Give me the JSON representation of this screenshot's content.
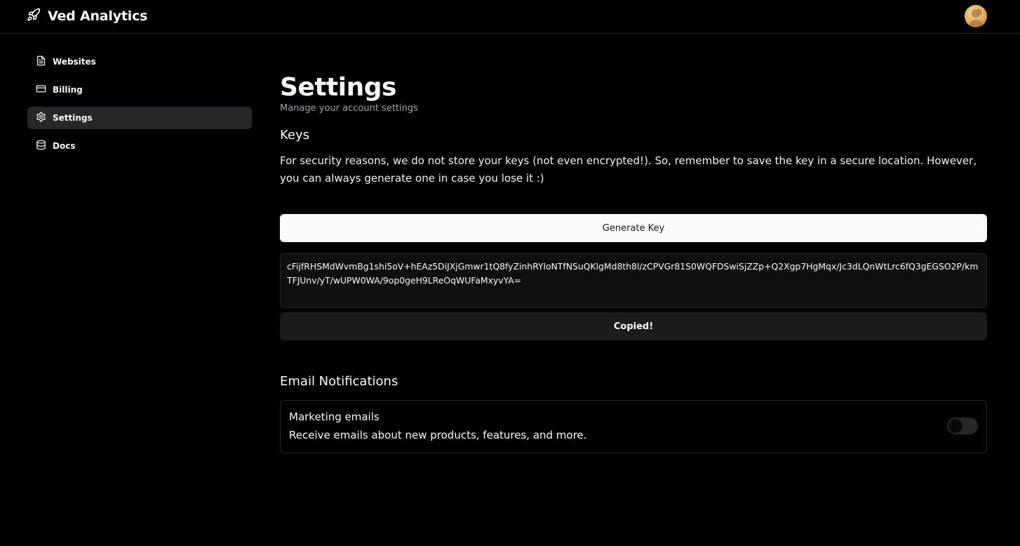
{
  "app": {
    "name": "Ved Analytics",
    "logo_icon": "rocket-icon"
  },
  "header": {
    "avatar_icon": "user-avatar"
  },
  "sidebar": {
    "items": [
      {
        "label": "Websites",
        "icon": "file-text-icon",
        "active": false
      },
      {
        "label": "Billing",
        "icon": "credit-card-icon",
        "active": false
      },
      {
        "label": "Settings",
        "icon": "gear-icon",
        "active": true
      },
      {
        "label": "Docs",
        "icon": "database-icon",
        "active": false
      }
    ]
  },
  "main": {
    "title": "Settings",
    "subtitle": "Manage your account settings",
    "keys": {
      "title": "Keys",
      "description": "For security reasons, we do not store your keys (not even encrypted!). So, remember to save the key in a secure location. However, you can always generate one in case you lose it :)",
      "generate_label": "Generate Key",
      "key_value": "cFijfRHSMdWvmBg1shi5oV+hEAz5DiJXjGmwr1tQ8fyZinhRYloNTfNSuQKlgMd8th8l/zCPVGr81S0WQFDSwiSjZZp+Q2Xgp7HgMqx/Jc3dLQnWtLrc6fQ3gEGSO2P/kmTFJUnv/yT/wUPW0WA/9op0geH9LReOqWUFaMxyvYA=",
      "copy_label": "Copied!"
    },
    "email": {
      "title": "Email Notifications",
      "marketing": {
        "label": "Marketing emails",
        "description": "Receive emails about new products, features, and more.",
        "enabled": false
      }
    }
  },
  "colors": {
    "background": "#000000",
    "border": "#27272a",
    "active_nav": "#27272a",
    "primary_button": "#fafafa",
    "muted_text": "#a1a1aa"
  }
}
